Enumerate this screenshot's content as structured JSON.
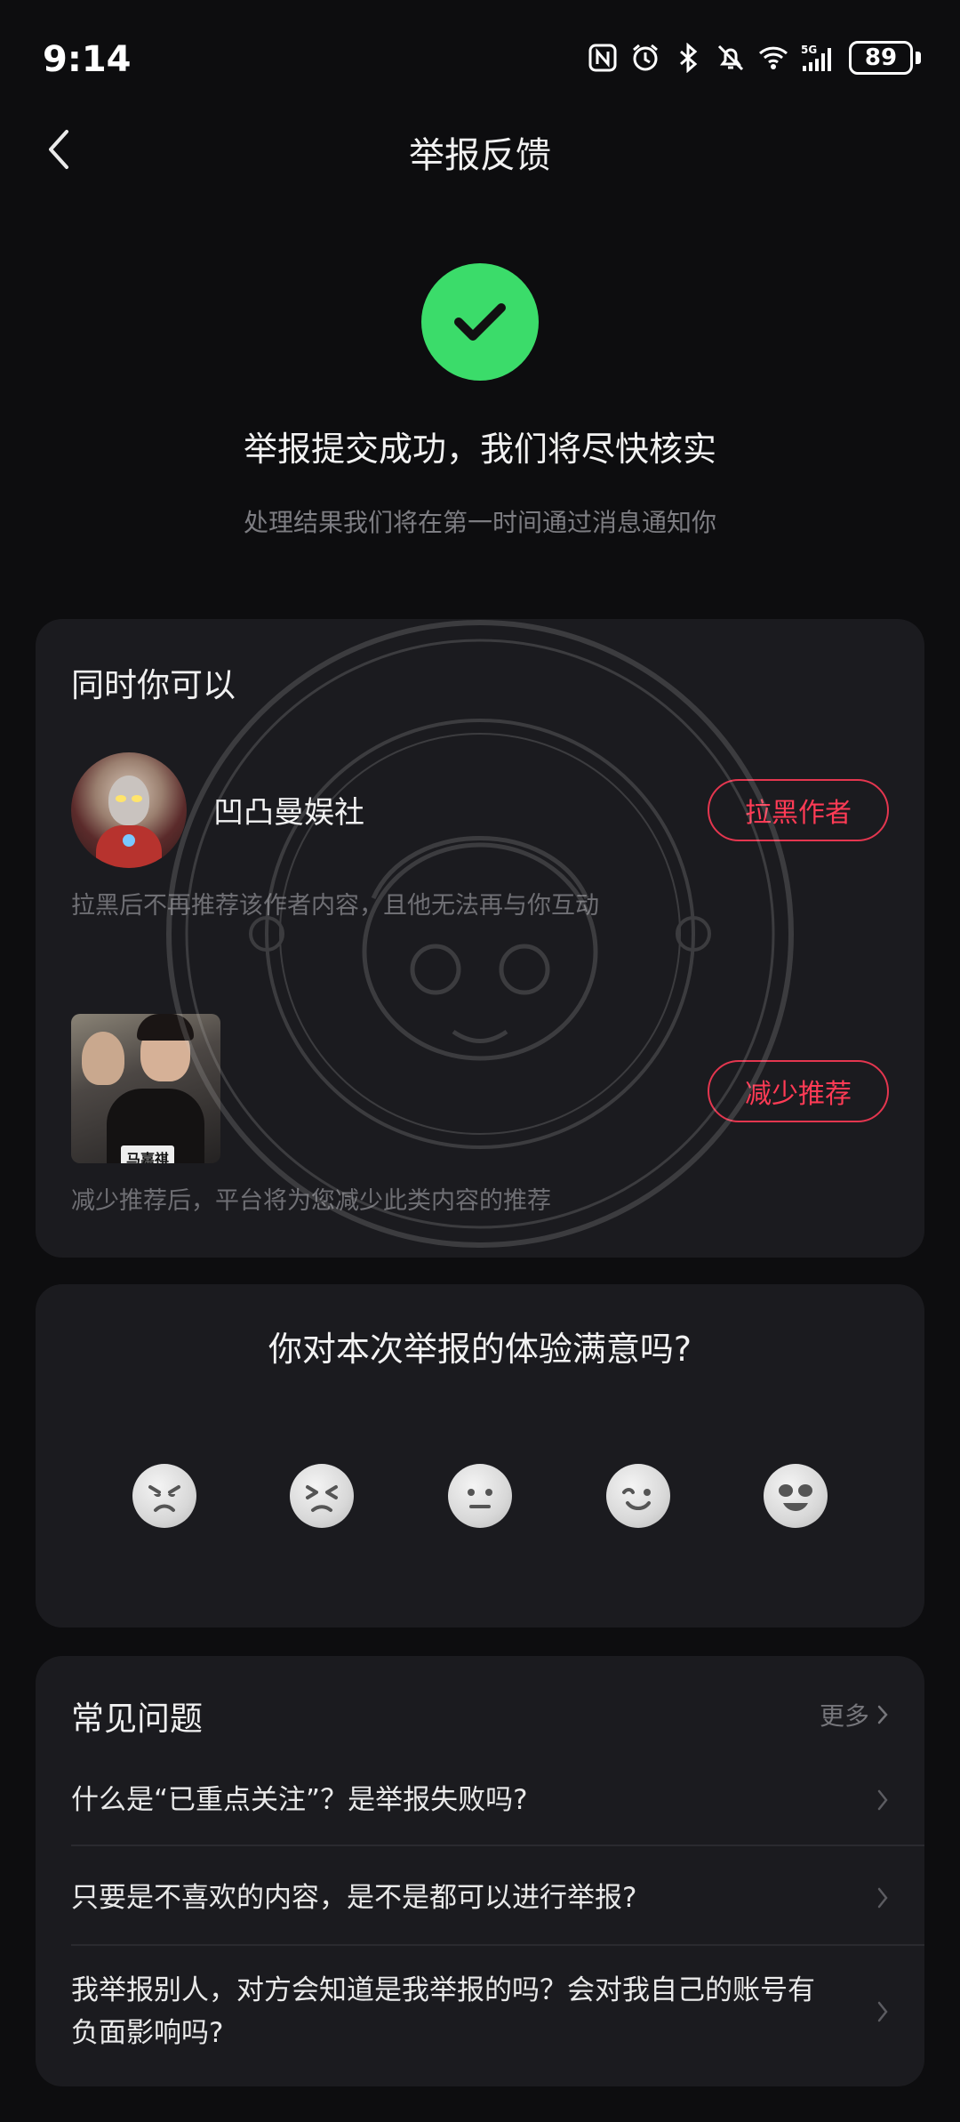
{
  "status_bar": {
    "time": "9:14",
    "battery": "89"
  },
  "header": {
    "title": "举报反馈"
  },
  "success": {
    "title": "举报提交成功，我们将尽快核实",
    "subtitle": "处理结果我们将在第一时间通过消息通知你"
  },
  "actions": {
    "heading": "同时你可以",
    "author_name": "凹凸曼娱社",
    "block_label": "拉黑作者",
    "block_desc": "拉黑后不再推荐该作者内容，且他无法再与你互动",
    "reduce_label": "减少推荐",
    "reduce_desc": "减少推荐后，平台将为您减少此类内容的推荐",
    "thumb_tag": "马嘉祺"
  },
  "rating": {
    "title": "你对本次举报的体验满意吗?",
    "faces": [
      "angry-face-icon",
      "frustrated-face-icon",
      "neutral-face-icon",
      "smiling-face-icon",
      "heart-eyes-face-icon"
    ]
  },
  "faq": {
    "heading": "常见问题",
    "more": "更多",
    "items": [
      {
        "question": "什么是“已重点关注”？是举报失败吗?"
      },
      {
        "question": "只要是不喜欢的内容，是不是都可以进行举报?"
      },
      {
        "question": "我举报别人，对方会知道是我举报的吗？会对我自己的账号有负面影响吗?"
      }
    ]
  },
  "colors": {
    "accent_green": "#3bdc6a",
    "accent_red": "#ff3b55",
    "background": "#0d0d0f",
    "card": "#1b1b1f"
  }
}
